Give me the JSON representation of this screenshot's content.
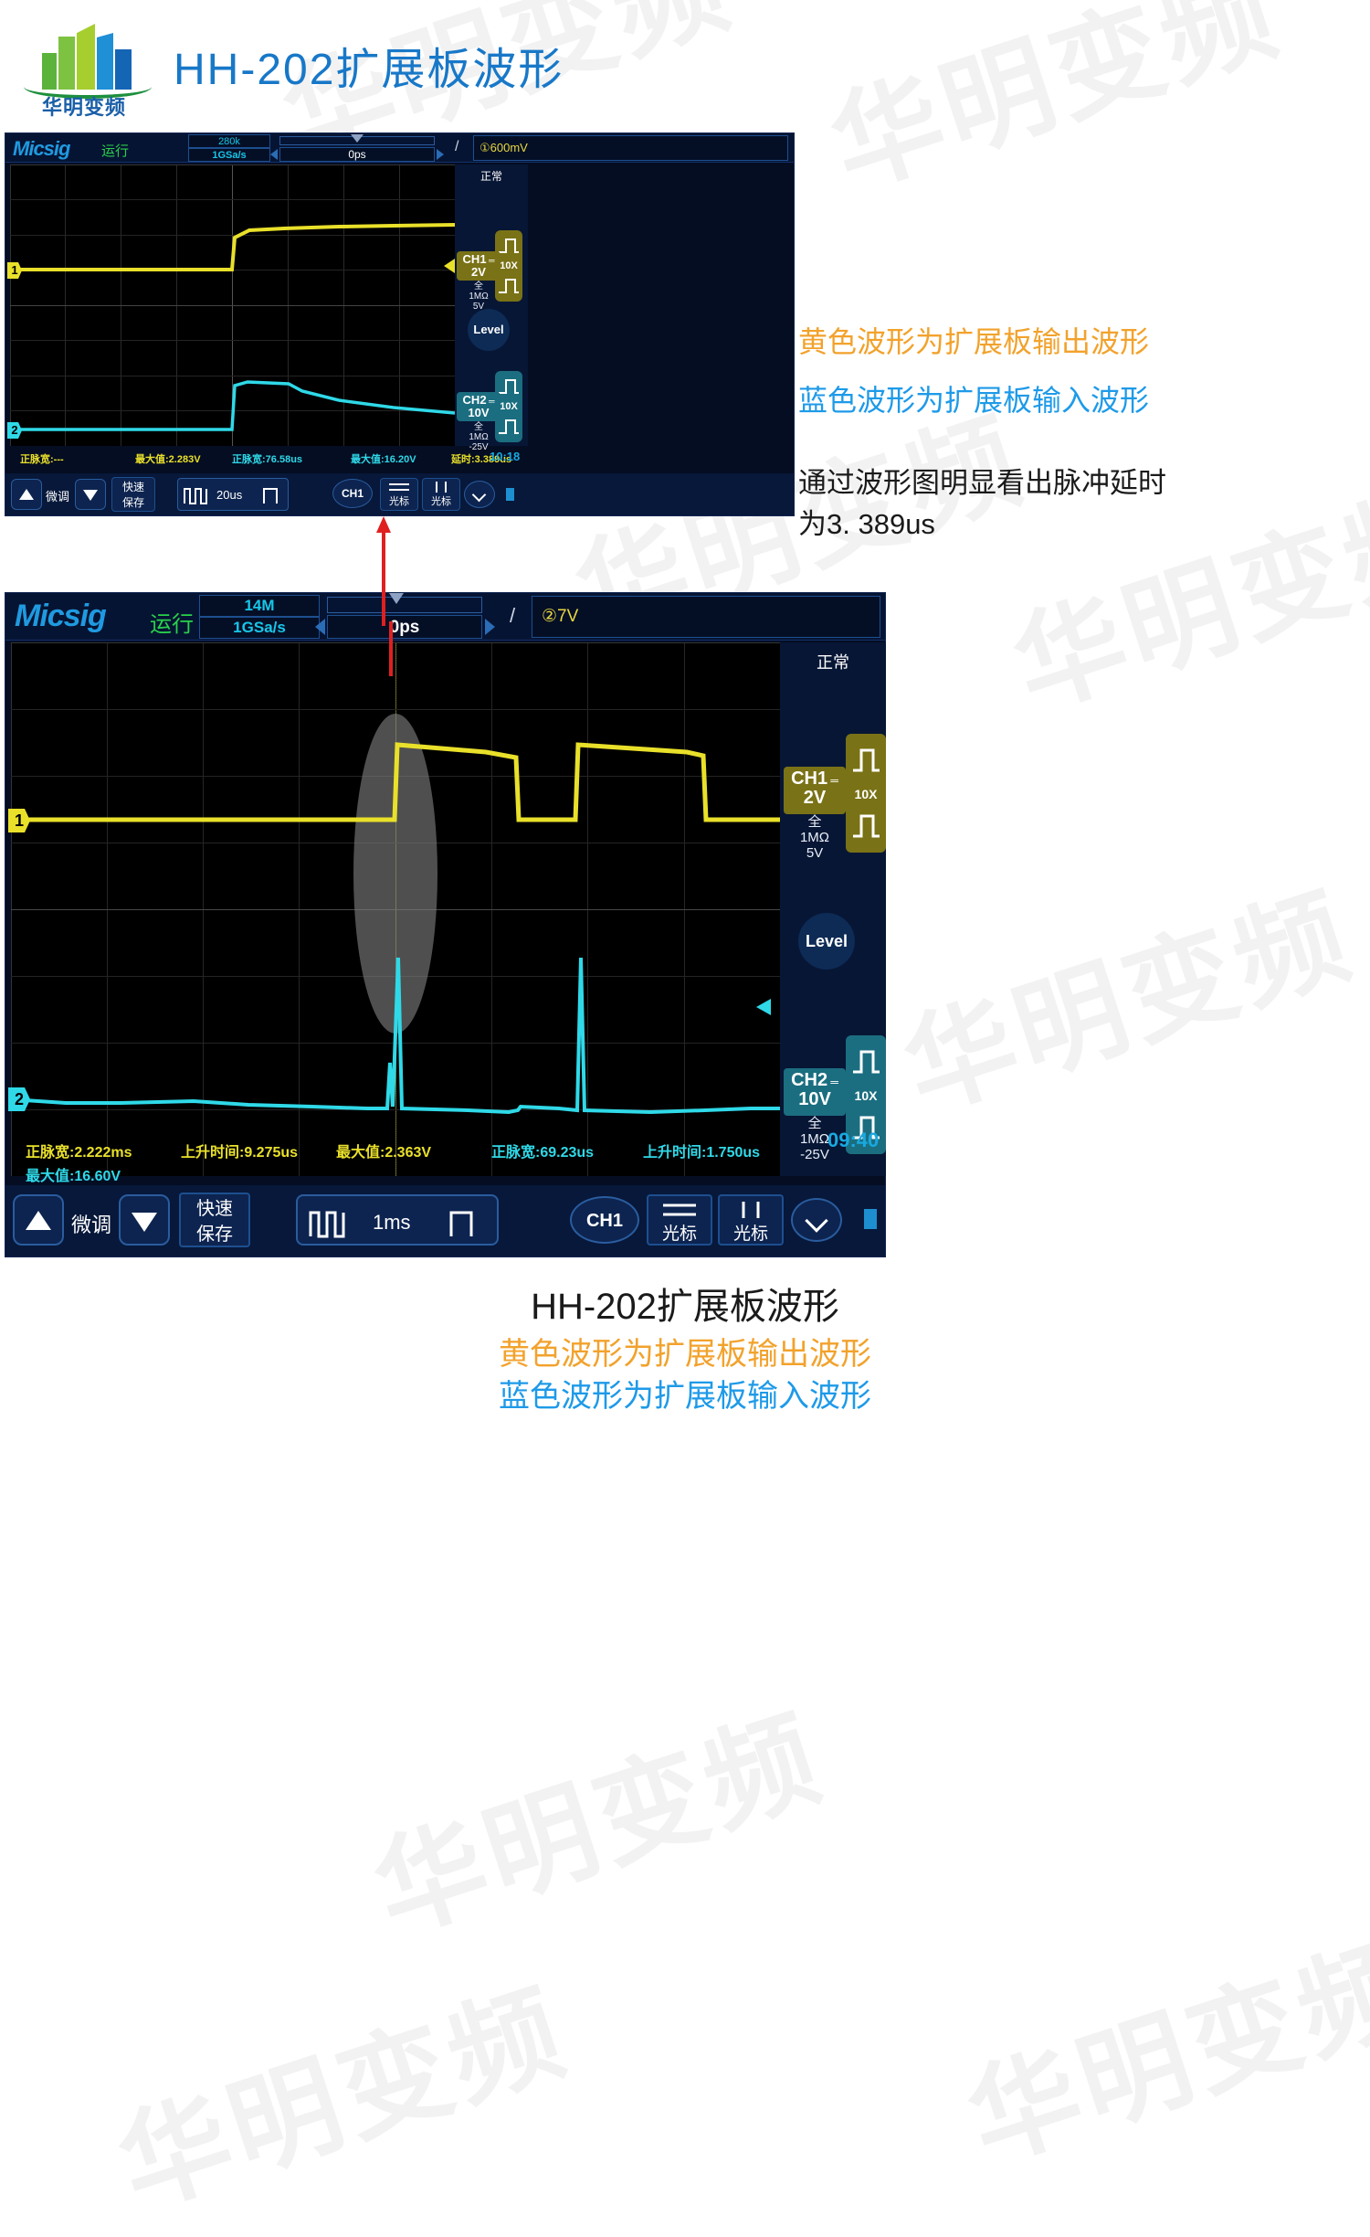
{
  "header": {
    "title": "HH-202扩展板波形",
    "logo_text": "华明变频",
    "title_color": "#1878c8"
  },
  "watermark_text": "华明变频",
  "annotations": {
    "line1": "黄色波形为扩展板输出波形",
    "line1_color": "#f2a22c",
    "line2": "蓝色波形为扩展板输入波形",
    "line2_color": "#1e9ae8",
    "line3": "通过波形图明显看出脉冲延时",
    "line4": "为3. 389us",
    "line34_color": "#1a1a1a"
  },
  "footer": {
    "title": "HH-202扩展板波形",
    "title_color": "#1a1a1a",
    "line2": "黄色波形为扩展板输出波形",
    "line2_color": "#f2a22c",
    "line3": "蓝色波形为扩展板输入波形",
    "line3_color": "#1e9ae8"
  },
  "scope_top": {
    "brand": "Micsig",
    "run_state": "运行",
    "memory_depth": "280k",
    "sample_rate": "1GSa/s",
    "time_position": "0ps",
    "slope": "/",
    "trigger_level": "①600mV",
    "trigger_mode": "正常",
    "ch1": {
      "name": "CH1",
      "coupling_icon": "dc-coupling-icon",
      "scale": "2V",
      "bandwidth": "全",
      "impedance": "1MΩ",
      "offset": "5V",
      "probe": "10X",
      "marker": "1",
      "color": "#e9e02a"
    },
    "ch2": {
      "name": "CH2",
      "coupling_icon": "dc-coupling-icon",
      "scale": "10V",
      "bandwidth": "全",
      "impedance": "1MΩ",
      "offset": "-25V",
      "probe": "10X",
      "marker": "2",
      "color": "#2fd9e8"
    },
    "level_label": "Level",
    "measurements": [
      {
        "label": "正脉宽:---",
        "color": "#e9e02a"
      },
      {
        "label": "最大值:2.283V",
        "color": "#e9e02a"
      },
      {
        "label": "正脉宽:76.58us",
        "color": "#2fd9e8"
      },
      {
        "label": "最大值:16.20V",
        "color": "#2fd9e8"
      },
      {
        "label": "延时:3.389us",
        "color": "#e9e02a"
      }
    ],
    "toolbar": {
      "fine_label": "微调",
      "up_icon": "triangle-up-icon",
      "down_icon": "triangle-down-icon",
      "quick_save": "快速\n保存",
      "quick_save_l1": "快速",
      "quick_save_l2": "保存",
      "timebase": "20us",
      "channel_btn": "CH1",
      "cursor_h": "光标",
      "cursor_v": "光标",
      "more_icon": "chevron-down-icon",
      "clock": "10:18"
    }
  },
  "scope_bottom": {
    "brand": "Micsig",
    "run_state": "运行",
    "memory_depth": "14M",
    "sample_rate": "1GSa/s",
    "time_position": "0ps",
    "slope": "/",
    "trigger_level": "②7V",
    "trigger_mode": "正常",
    "ch1": {
      "name": "CH1",
      "scale": "2V",
      "bandwidth": "全",
      "impedance": "1MΩ",
      "offset": "5V",
      "probe": "10X",
      "marker": "1",
      "color": "#e9e02a"
    },
    "ch2": {
      "name": "CH2",
      "scale": "10V",
      "bandwidth": "全",
      "impedance": "1MΩ",
      "offset": "-25V",
      "probe": "10X",
      "marker": "2",
      "color": "#2fd9e8"
    },
    "level_label": "Level",
    "measurements_row1": [
      {
        "label": "正脉宽:2.222ms",
        "color": "#e9e02a"
      },
      {
        "label": "上升时间:9.275us",
        "color": "#e9e02a"
      },
      {
        "label": "最大值:2.363V",
        "color": "#e9e02a"
      },
      {
        "label": "正脉宽:69.23us",
        "color": "#2fd9e8"
      },
      {
        "label": "上升时间:1.750us",
        "color": "#2fd9e8"
      }
    ],
    "measurements_row2": [
      {
        "label": "最大值:16.60V",
        "color": "#2fd9e8"
      }
    ],
    "toolbar": {
      "fine_label": "微调",
      "up_icon": "triangle-up-icon",
      "down_icon": "triangle-down-icon",
      "quick_save_l1": "快速",
      "quick_save_l2": "保存",
      "timebase": "1ms",
      "channel_btn": "CH1",
      "cursor_h": "光标",
      "cursor_v": "光标",
      "more_icon": "chevron-down-icon",
      "clock": "09:40"
    }
  }
}
